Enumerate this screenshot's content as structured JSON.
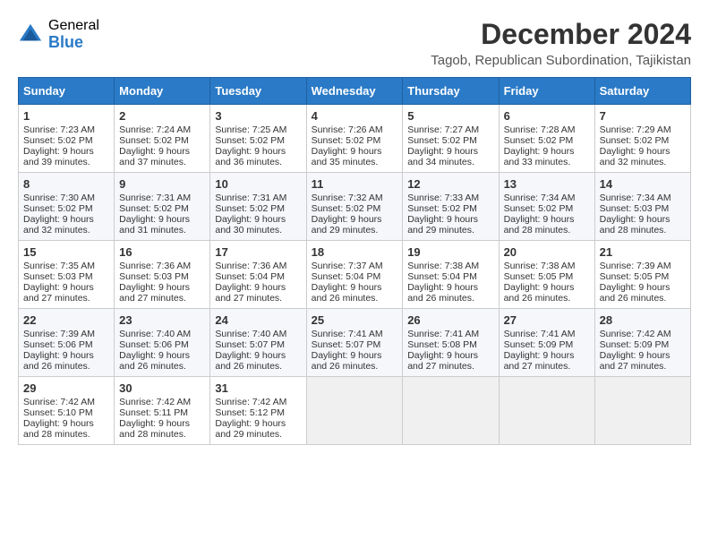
{
  "header": {
    "logo_general": "General",
    "logo_blue": "Blue",
    "month": "December 2024",
    "location": "Tagob, Republican Subordination, Tajikistan"
  },
  "weekdays": [
    "Sunday",
    "Monday",
    "Tuesday",
    "Wednesday",
    "Thursday",
    "Friday",
    "Saturday"
  ],
  "weeks": [
    [
      {
        "day": "1",
        "lines": [
          "Sunrise: 7:23 AM",
          "Sunset: 5:02 PM",
          "Daylight: 9 hours and 39 minutes."
        ]
      },
      {
        "day": "2",
        "lines": [
          "Sunrise: 7:24 AM",
          "Sunset: 5:02 PM",
          "Daylight: 9 hours and 37 minutes."
        ]
      },
      {
        "day": "3",
        "lines": [
          "Sunrise: 7:25 AM",
          "Sunset: 5:02 PM",
          "Daylight: 9 hours and 36 minutes."
        ]
      },
      {
        "day": "4",
        "lines": [
          "Sunrise: 7:26 AM",
          "Sunset: 5:02 PM",
          "Daylight: 9 hours and 35 minutes."
        ]
      },
      {
        "day": "5",
        "lines": [
          "Sunrise: 7:27 AM",
          "Sunset: 5:02 PM",
          "Daylight: 9 hours and 34 minutes."
        ]
      },
      {
        "day": "6",
        "lines": [
          "Sunrise: 7:28 AM",
          "Sunset: 5:02 PM",
          "Daylight: 9 hours and 33 minutes."
        ]
      },
      {
        "day": "7",
        "lines": [
          "Sunrise: 7:29 AM",
          "Sunset: 5:02 PM",
          "Daylight: 9 hours and 32 minutes."
        ]
      }
    ],
    [
      {
        "day": "8",
        "lines": [
          "Sunrise: 7:30 AM",
          "Sunset: 5:02 PM",
          "Daylight: 9 hours and 32 minutes."
        ]
      },
      {
        "day": "9",
        "lines": [
          "Sunrise: 7:31 AM",
          "Sunset: 5:02 PM",
          "Daylight: 9 hours and 31 minutes."
        ]
      },
      {
        "day": "10",
        "lines": [
          "Sunrise: 7:31 AM",
          "Sunset: 5:02 PM",
          "Daylight: 9 hours and 30 minutes."
        ]
      },
      {
        "day": "11",
        "lines": [
          "Sunrise: 7:32 AM",
          "Sunset: 5:02 PM",
          "Daylight: 9 hours and 29 minutes."
        ]
      },
      {
        "day": "12",
        "lines": [
          "Sunrise: 7:33 AM",
          "Sunset: 5:02 PM",
          "Daylight: 9 hours and 29 minutes."
        ]
      },
      {
        "day": "13",
        "lines": [
          "Sunrise: 7:34 AM",
          "Sunset: 5:02 PM",
          "Daylight: 9 hours and 28 minutes."
        ]
      },
      {
        "day": "14",
        "lines": [
          "Sunrise: 7:34 AM",
          "Sunset: 5:03 PM",
          "Daylight: 9 hours and 28 minutes."
        ]
      }
    ],
    [
      {
        "day": "15",
        "lines": [
          "Sunrise: 7:35 AM",
          "Sunset: 5:03 PM",
          "Daylight: 9 hours and 27 minutes."
        ]
      },
      {
        "day": "16",
        "lines": [
          "Sunrise: 7:36 AM",
          "Sunset: 5:03 PM",
          "Daylight: 9 hours and 27 minutes."
        ]
      },
      {
        "day": "17",
        "lines": [
          "Sunrise: 7:36 AM",
          "Sunset: 5:04 PM",
          "Daylight: 9 hours and 27 minutes."
        ]
      },
      {
        "day": "18",
        "lines": [
          "Sunrise: 7:37 AM",
          "Sunset: 5:04 PM",
          "Daylight: 9 hours and 26 minutes."
        ]
      },
      {
        "day": "19",
        "lines": [
          "Sunrise: 7:38 AM",
          "Sunset: 5:04 PM",
          "Daylight: 9 hours and 26 minutes."
        ]
      },
      {
        "day": "20",
        "lines": [
          "Sunrise: 7:38 AM",
          "Sunset: 5:05 PM",
          "Daylight: 9 hours and 26 minutes."
        ]
      },
      {
        "day": "21",
        "lines": [
          "Sunrise: 7:39 AM",
          "Sunset: 5:05 PM",
          "Daylight: 9 hours and 26 minutes."
        ]
      }
    ],
    [
      {
        "day": "22",
        "lines": [
          "Sunrise: 7:39 AM",
          "Sunset: 5:06 PM",
          "Daylight: 9 hours and 26 minutes."
        ]
      },
      {
        "day": "23",
        "lines": [
          "Sunrise: 7:40 AM",
          "Sunset: 5:06 PM",
          "Daylight: 9 hours and 26 minutes."
        ]
      },
      {
        "day": "24",
        "lines": [
          "Sunrise: 7:40 AM",
          "Sunset: 5:07 PM",
          "Daylight: 9 hours and 26 minutes."
        ]
      },
      {
        "day": "25",
        "lines": [
          "Sunrise: 7:41 AM",
          "Sunset: 5:07 PM",
          "Daylight: 9 hours and 26 minutes."
        ]
      },
      {
        "day": "26",
        "lines": [
          "Sunrise: 7:41 AM",
          "Sunset: 5:08 PM",
          "Daylight: 9 hours and 27 minutes."
        ]
      },
      {
        "day": "27",
        "lines": [
          "Sunrise: 7:41 AM",
          "Sunset: 5:09 PM",
          "Daylight: 9 hours and 27 minutes."
        ]
      },
      {
        "day": "28",
        "lines": [
          "Sunrise: 7:42 AM",
          "Sunset: 5:09 PM",
          "Daylight: 9 hours and 27 minutes."
        ]
      }
    ],
    [
      {
        "day": "29",
        "lines": [
          "Sunrise: 7:42 AM",
          "Sunset: 5:10 PM",
          "Daylight: 9 hours and 28 minutes."
        ]
      },
      {
        "day": "30",
        "lines": [
          "Sunrise: 7:42 AM",
          "Sunset: 5:11 PM",
          "Daylight: 9 hours and 28 minutes."
        ]
      },
      {
        "day": "31",
        "lines": [
          "Sunrise: 7:42 AM",
          "Sunset: 5:12 PM",
          "Daylight: 9 hours and 29 minutes."
        ]
      },
      null,
      null,
      null,
      null
    ]
  ]
}
